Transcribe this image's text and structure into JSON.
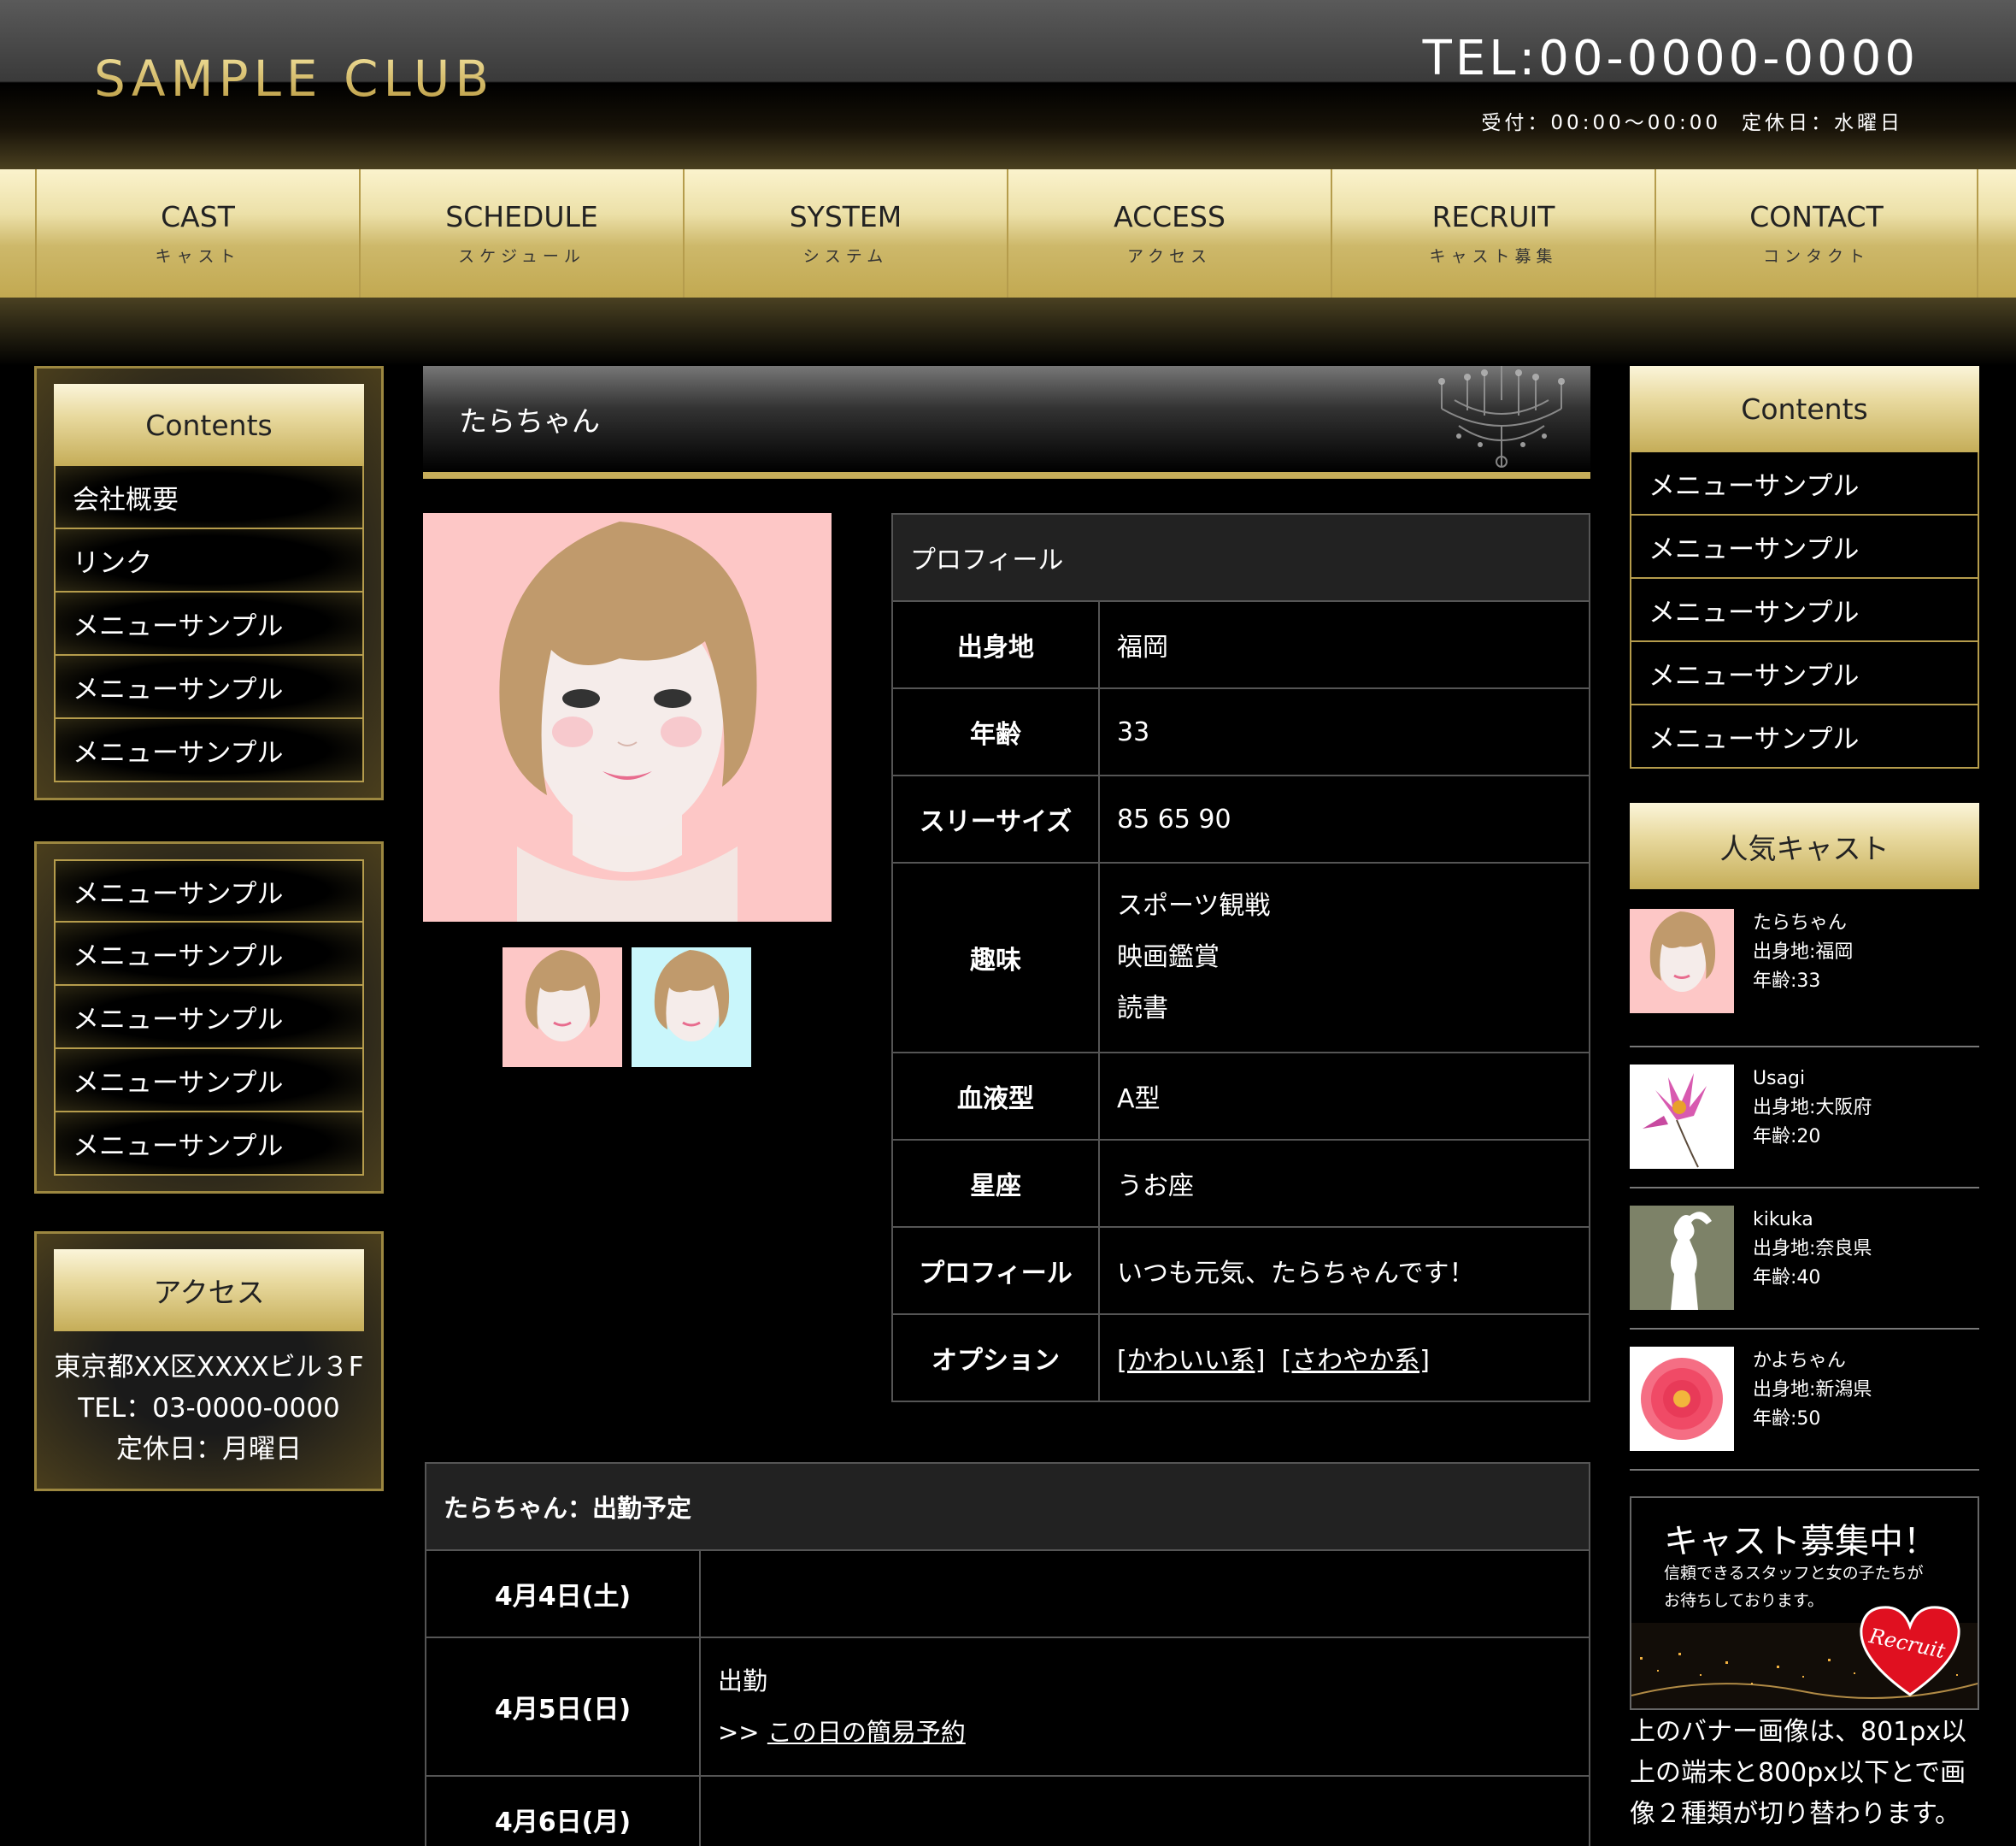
{
  "header": {
    "logo": "SAMPLE CLUB",
    "tel": "TEL:00-0000-0000",
    "reception": "受付：00:00〜00:00",
    "holiday": "定休日：水曜日"
  },
  "nav": [
    {
      "en": "CAST",
      "ja": "キャスト"
    },
    {
      "en": "SCHEDULE",
      "ja": "スケジュール"
    },
    {
      "en": "SYSTEM",
      "ja": "システム"
    },
    {
      "en": "ACCESS",
      "ja": "アクセス"
    },
    {
      "en": "RECRUIT",
      "ja": "キャスト募集"
    },
    {
      "en": "CONTACT",
      "ja": "コンタクト"
    }
  ],
  "left": {
    "contents_title": "Contents",
    "contents_items": [
      "会社概要",
      "リンク",
      "メニューサンプル",
      "メニューサンプル",
      "メニューサンプル"
    ],
    "menu_items": [
      "メニューサンプル",
      "メニューサンプル",
      "メニューサンプル",
      "メニューサンプル",
      "メニューサンプル"
    ],
    "access_title": "アクセス",
    "access_address": "東京都XX区XXXXビル３F",
    "access_tel": "TEL：03-0000-0000",
    "access_holiday": "定休日：月曜日"
  },
  "main": {
    "cast_name": "たらちゃん",
    "profile": {
      "header": "プロフィール",
      "birthplace_label": "出身地",
      "birthplace": "福岡",
      "age_label": "年齢",
      "age": "33",
      "size_label": "スリーサイズ",
      "size": "85 65 90",
      "hobby_label": "趣味",
      "hobby": [
        "スポーツ観戦",
        "映画鑑賞",
        "読書"
      ],
      "blood_label": "血液型",
      "blood": "A型",
      "sign_label": "星座",
      "sign": "うお座",
      "intro_label": "プロフィール",
      "intro": "いつも元気、たらちゃんです！",
      "option_label": "オプション",
      "option1": "[かわいい系]",
      "option2": "[さわやか系]"
    },
    "schedule": {
      "header": "たらちゃん：出勤予定",
      "rows": [
        {
          "date": "4月4日(土)",
          "status": "",
          "link": ""
        },
        {
          "date": "4月5日(日)",
          "status": "出勤",
          "prefix": ">>",
          "link": "この日の簡易予約"
        },
        {
          "date": "4月6日(月)",
          "status": "",
          "link": ""
        }
      ]
    }
  },
  "right": {
    "contents_title": "Contents",
    "contents_items": [
      "メニューサンプル",
      "メニューサンプル",
      "メニューサンプル",
      "メニューサンプル",
      "メニューサンプル"
    ],
    "popular_title": "人気キャスト",
    "casts": [
      {
        "name": "たらちゃん",
        "from": "出身地:福岡",
        "age": "年齢:33"
      },
      {
        "name": "Usagi",
        "from": "出身地:大阪府",
        "age": "年齢:20"
      },
      {
        "name": "kikuka",
        "from": "出身地:奈良県",
        "age": "年齢:40"
      },
      {
        "name": "かよちゃん",
        "from": "出身地:新潟県",
        "age": "年齢:50"
      }
    ],
    "recruit_title": "キャスト募集中！",
    "recruit_sub1": "信頼できるスタッフと女の子たちが",
    "recruit_sub2": "お待ちしております。",
    "recruit_badge": "Recruit",
    "note": "上のバナー画像は、801px以上の端末と800px以下とで画像２種類が切り替わります。"
  },
  "colors": {
    "gold": "#c6ad5a",
    "background": "#000000",
    "table_border": "#555555"
  }
}
